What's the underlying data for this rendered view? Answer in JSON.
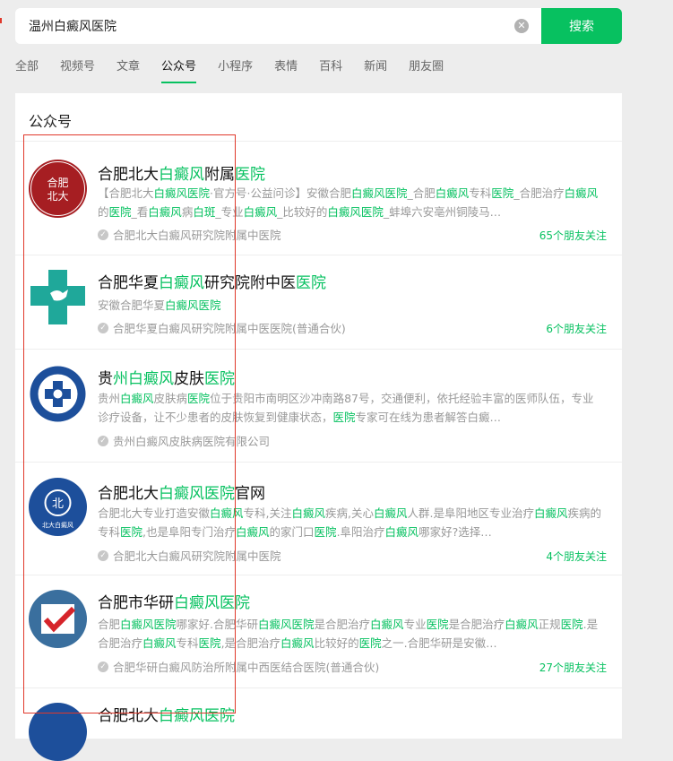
{
  "search": {
    "query": "温州白癜风医院",
    "button_label": "搜索",
    "clear_icon": "clear-icon"
  },
  "tabs": [
    "全部",
    "视频号",
    "文章",
    "公众号",
    "小程序",
    "表情",
    "百科",
    "新闻",
    "朋友圈"
  ],
  "active_tab": "公众号",
  "section_title": "公众号",
  "accent_color": "#07c160",
  "items": [
    {
      "title_parts": [
        "合肥北大",
        "白癜风",
        "附属",
        "医院"
      ],
      "desc": "【合肥北大白癜风医院·官方号·公益问诊】安徽合肥白癜风医院_合肥白癜风专科医院_合肥治疗白癜风的医院_看白癜风病白斑_专业白癜风_比较好的白癜风医院_蚌埠六安亳州铜陵马…",
      "source": "合肥北大白癜风研究院附属中医院",
      "friends": "65个朋友关注",
      "avatar_text": "合肥\n北大"
    },
    {
      "title_parts": [
        "合肥华夏",
        "白癜风",
        "研究院附中医",
        "医院"
      ],
      "desc": "安徽合肥华夏白癜风医院",
      "source": "合肥华夏白癜风研究院附属中医医院(普通合伙)",
      "friends": "6个朋友关注"
    },
    {
      "title_parts": [
        "贵",
        "州白癜风",
        "皮肤",
        "医院"
      ],
      "desc": "贵州白癜风皮肤病医院位于贵阳市南明区沙冲南路87号，交通便利，依托经验丰富的医师队伍，专业诊疗设备，让不少患者的皮肤恢复到健康状态，医院专家可在线为患者解答白癜…",
      "source": "贵州白癜风皮肤病医院有限公司",
      "friends": ""
    },
    {
      "title_parts": [
        "合肥北大",
        "白癜风医院",
        "官网",
        ""
      ],
      "desc": "合肥北大专业打造安徽白癜风专科,关注白癜风疾病,关心白癜风人群.是阜阳地区专业治疗白癜风疾病的专科医院,也是阜阳专门治疗白癜风的家门口医院.阜阳治疗白癜风哪家好?选择…",
      "source": "合肥北大白癜风研究院附属中医院",
      "friends": "4个朋友关注"
    },
    {
      "title_parts": [
        "合肥市华研",
        "白癜风医院",
        "",
        ""
      ],
      "desc": "合肥白癜风医院哪家好.合肥华研白癜风医院是合肥治疗白癜风专业医院是合肥治疗白癜风正规医院.是合肥治疗白癜风专科医院,是合肥治疗白癜风比较好的医院之一.合肥华研是安徽…",
      "source": "合肥华研白癜风防治所附属中西医结合医院(普通合伙)",
      "friends": "27个朋友关注"
    },
    {
      "title_parts": [
        "合肥北大",
        "白癜风医院",
        "",
        ""
      ],
      "desc": "",
      "source": "",
      "friends": ""
    }
  ]
}
